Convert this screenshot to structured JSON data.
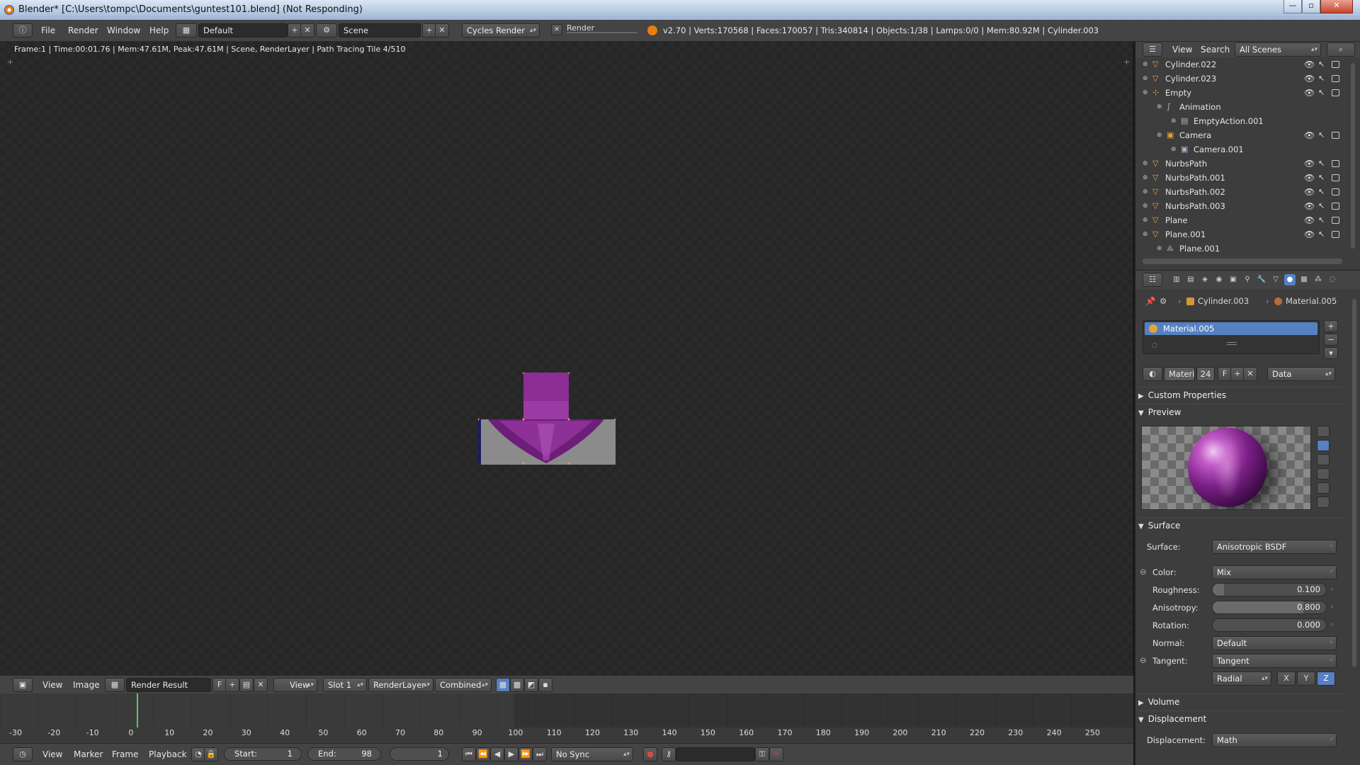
{
  "window": {
    "title": "Blender* [C:\\Users\\tompc\\Documents\\guntest101.blend] (Not Responding)",
    "minimize": "—",
    "maximize": "▫",
    "close": "✕"
  },
  "menubar": {
    "items": [
      "File",
      "Render",
      "Window",
      "Help"
    ],
    "layout": "Default",
    "scene": "Scene",
    "engine": "Cycles Render",
    "render_field": "Render",
    "stats": "v2.70 | Verts:170568 | Faces:170057 | Tris:340814 | Objects:1/38 | Lamps:0/0 | Mem:80.92M | Cylinder.003"
  },
  "editor": {
    "frame_info": "Frame:1 | Time:00:01.76 | Mem:47.61M, Peak:47.61M | Scene, RenderLayer | Path Tracing Tile 4/510"
  },
  "image_header": {
    "view": "View",
    "image": "Image",
    "image_name": "Render Result",
    "fake_user": "F",
    "view_mode": "View",
    "slot": "Slot 1",
    "layer": "RenderLayer",
    "pass": "Combined"
  },
  "timeline": {
    "ticks": [
      "-30",
      "-20",
      "-10",
      "0",
      "10",
      "20",
      "30",
      "40",
      "50",
      "60",
      "70",
      "80",
      "90",
      "100",
      "110",
      "120",
      "130",
      "140",
      "150",
      "160",
      "170",
      "180",
      "190",
      "200",
      "210",
      "220",
      "230",
      "240",
      "250"
    ],
    "menus": [
      "View",
      "Marker",
      "Frame",
      "Playback"
    ],
    "start_label": "Start:",
    "start_value": "1",
    "end_label": "End:",
    "end_value": "98",
    "current_frame": "1",
    "sync": "No Sync"
  },
  "outliner": {
    "view": "View",
    "search": "Search",
    "display_mode": "All Scenes",
    "rows": [
      {
        "label": "Cylinder.022",
        "type": "mesh"
      },
      {
        "label": "Cylinder.023",
        "type": "mesh"
      },
      {
        "label": "Empty",
        "type": "empty"
      },
      {
        "label": "Animation",
        "type": "animation"
      },
      {
        "label": "EmptyAction.001",
        "type": "action"
      },
      {
        "label": "Camera",
        "type": "camera"
      },
      {
        "label": "Camera.001",
        "type": "camera-data"
      },
      {
        "label": "NurbsPath",
        "type": "curve"
      },
      {
        "label": "NurbsPath.001",
        "type": "curve"
      },
      {
        "label": "NurbsPath.002",
        "type": "curve"
      },
      {
        "label": "NurbsPath.003",
        "type": "curve"
      },
      {
        "label": "Plane",
        "type": "mesh"
      },
      {
        "label": "Plane.001",
        "type": "mesh"
      },
      {
        "label": "Plane.001",
        "type": "mesh-data"
      }
    ]
  },
  "properties": {
    "breadcrumb_object": "Cylinder.003",
    "breadcrumb_material": "Material.005",
    "material_slot": "Material.005",
    "datablock_label": "Material",
    "users": "24",
    "fake": "F",
    "link": "Data",
    "sections": {
      "custom_properties": "Custom Properties",
      "preview": "Preview",
      "surface": "Surface",
      "volume": "Volume",
      "displacement": "Displacement"
    },
    "surface": {
      "surface_label": "Surface:",
      "surface_value": "Anisotropic BSDF",
      "color_label": "Color:",
      "color_value": "Mix",
      "roughness_label": "Roughness:",
      "roughness_value": "0.100",
      "roughness_fraction": 0.1,
      "anisotropy_label": "Anisotropy:",
      "anisotropy_value": "0.800",
      "anisotropy_fraction": 0.8,
      "rotation_label": "Rotation:",
      "rotation_value": "0.000",
      "rotation_fraction": 0.0,
      "normal_label": "Normal:",
      "normal_value": "Default",
      "tangent_label": "Tangent:",
      "tangent_value": "Tangent",
      "radial": "Radial",
      "axes": [
        "X",
        "Y",
        "Z"
      ],
      "axis_selected": "Z"
    },
    "displacement": {
      "label": "Displacement:",
      "value": "Math"
    }
  },
  "colors": {
    "accent": "#5680c2",
    "material": "#8a2a94",
    "playhead": "#5ec95e"
  }
}
